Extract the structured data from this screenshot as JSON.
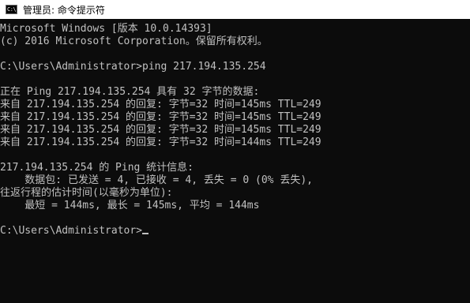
{
  "window": {
    "title": "管理员: 命令提示符",
    "icon_text": "C:\\"
  },
  "console": {
    "lines": [
      "Microsoft Windows [版本 10.0.14393]",
      "(c) 2016 Microsoft Corporation。保留所有权利。",
      "",
      "C:\\Users\\Administrator>ping 217.194.135.254",
      "",
      "正在 Ping 217.194.135.254 具有 32 字节的数据:",
      "来自 217.194.135.254 的回复: 字节=32 时间=145ms TTL=249",
      "来自 217.194.135.254 的回复: 字节=32 时间=145ms TTL=249",
      "来自 217.194.135.254 的回复: 字节=32 时间=145ms TTL=249",
      "来自 217.194.135.254 的回复: 字节=32 时间=144ms TTL=249",
      "",
      "217.194.135.254 的 Ping 统计信息:",
      "    数据包: 已发送 = 4, 已接收 = 4, 丢失 = 0 (0% 丢失),",
      "往返行程的估计时间(以毫秒为单位):",
      "    最短 = 144ms, 最长 = 145ms, 平均 = 144ms",
      "",
      "C:\\Users\\Administrator>"
    ]
  },
  "colors": {
    "console_bg": "#0c0c0c",
    "console_text": "#c0c0c0",
    "titlebar_bg": "#ffffff"
  }
}
